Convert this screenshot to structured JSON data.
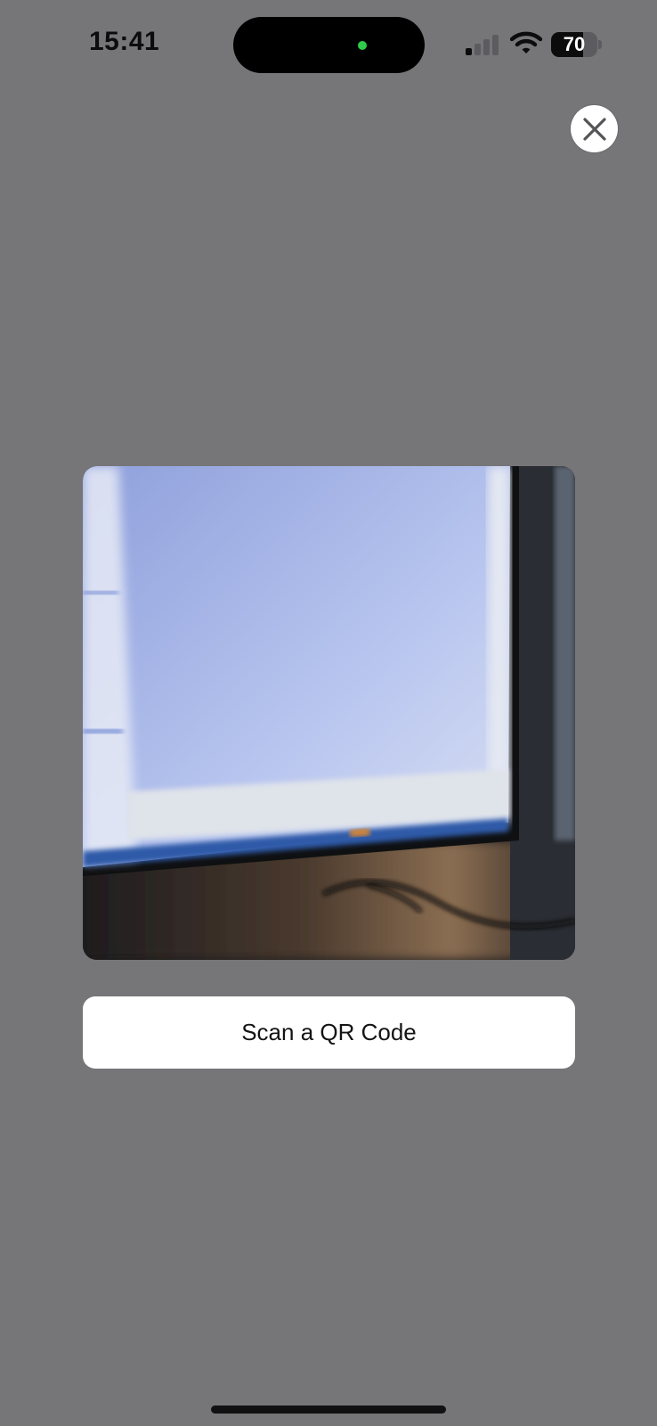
{
  "status_bar": {
    "time": "15:41",
    "battery_percent": "70",
    "battery_level": 0.7,
    "signal_bars_active": 1,
    "signal_bars_total": 4,
    "camera_indicator_color": "#2ecc4a",
    "icons": [
      "cellular-signal-icon",
      "wifi-icon",
      "battery-icon"
    ]
  },
  "close_button": {
    "icon": "close-icon"
  },
  "camera": {
    "label": "camera-preview"
  },
  "scan_button": {
    "label": "Scan a QR Code"
  },
  "colors": {
    "background": "#767578",
    "button_background": "#ffffff"
  }
}
